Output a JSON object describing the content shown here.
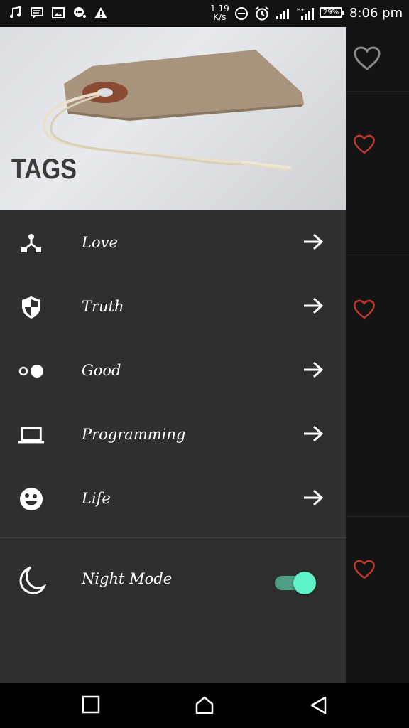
{
  "status_bar": {
    "speed_value": "1.19",
    "speed_unit": "K/s",
    "battery": "29%",
    "time": "8:06 pm"
  },
  "drawer": {
    "header_title": "TAGS",
    "items": [
      {
        "label": "Love",
        "icon": "network-icon"
      },
      {
        "label": "Truth",
        "icon": "shield-icon"
      },
      {
        "label": "Good",
        "icon": "dots-icon"
      },
      {
        "label": "Programming",
        "icon": "laptop-icon"
      },
      {
        "label": "Life",
        "icon": "face-icon"
      }
    ],
    "night_mode": {
      "label": "Night Mode",
      "enabled": true
    }
  },
  "colors": {
    "drawer_bg": "#2f2f2f",
    "toggle_track": "#4f9f87",
    "toggle_knob": "#5ef2c8",
    "heart_red": "#c0392b"
  }
}
